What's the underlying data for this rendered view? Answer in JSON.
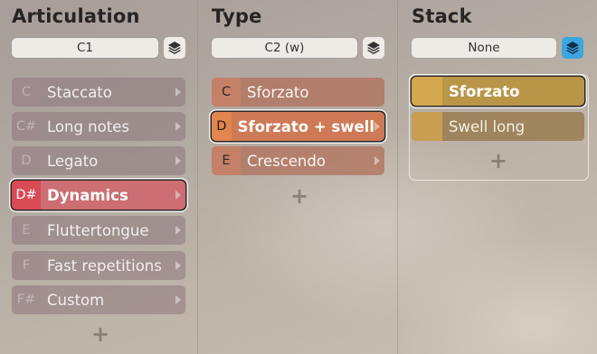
{
  "articulation": {
    "title": "Articulation",
    "selector_value": "C1",
    "items": [
      {
        "key": "C",
        "label": "Staccato"
      },
      {
        "key": "C#",
        "label": "Long notes"
      },
      {
        "key": "D",
        "label": "Legato"
      },
      {
        "key": "D#",
        "label": "Dynamics"
      },
      {
        "key": "E",
        "label": "Fluttertongue"
      },
      {
        "key": "F",
        "label": "Fast repetitions"
      },
      {
        "key": "F#",
        "label": "Custom"
      }
    ],
    "selected_index": 3,
    "add_label": "+"
  },
  "type": {
    "title": "Type",
    "selector_value": "C2 (w)",
    "items": [
      {
        "key": "C",
        "label": "Sforzato"
      },
      {
        "key": "D",
        "label": "Sforzato + swell"
      },
      {
        "key": "E",
        "label": "Crescendo"
      }
    ],
    "selected_index": 1,
    "add_label": "+"
  },
  "stack": {
    "title": "Stack",
    "selector_value": "None",
    "stack_toggle_active": true,
    "items": [
      {
        "label": "Sforzato"
      },
      {
        "label": "Swell long"
      }
    ],
    "selected_index": 0,
    "add_label": "+"
  },
  "icons": {
    "stack_toggle": "layers-icon",
    "submenu_arrow": "chevron-right-icon",
    "add": "plus-icon"
  },
  "colors": {
    "articulation_selected": "#d94a55",
    "type_item": "#c6826a",
    "stack_item": "#c79e52",
    "stack_toggle_active": "#3da5e0"
  }
}
